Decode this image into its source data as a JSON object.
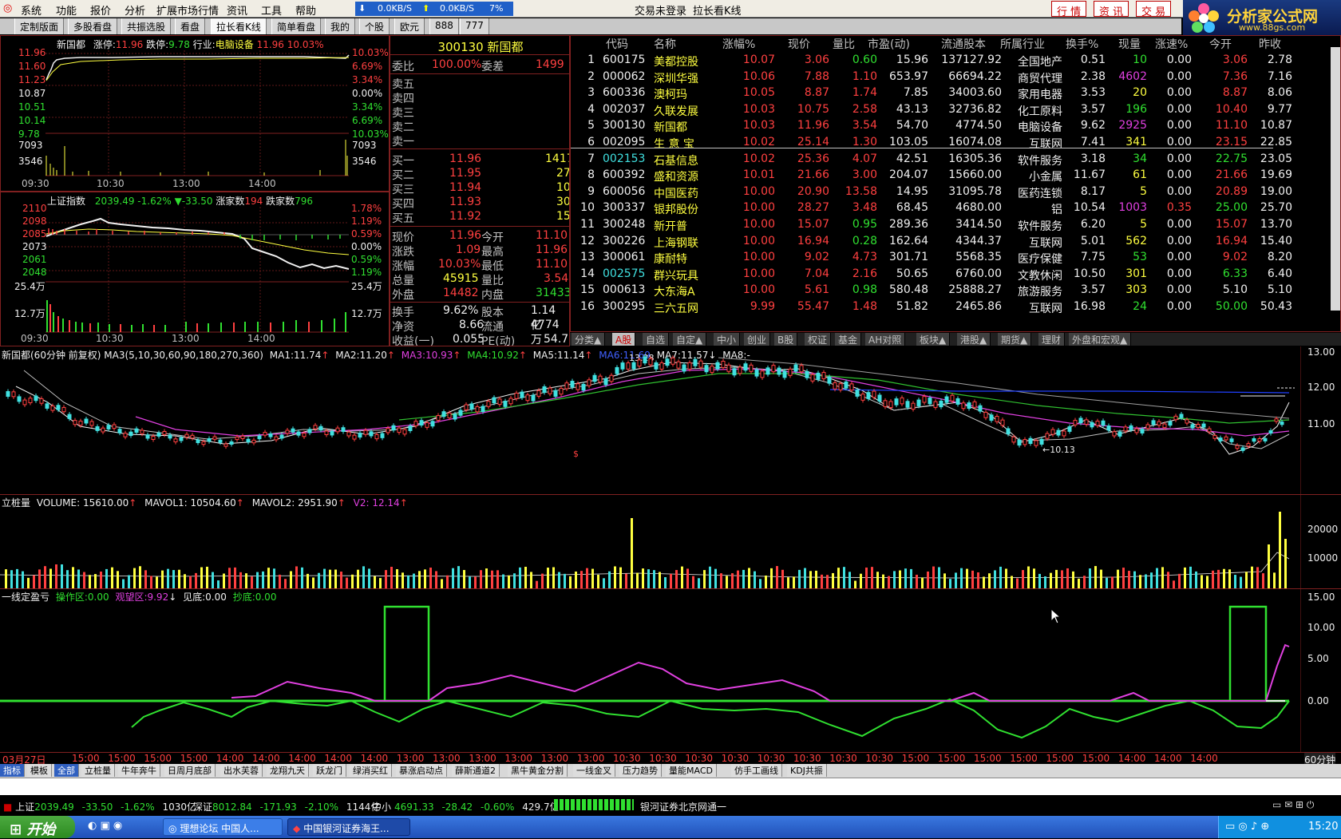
{
  "menu": {
    "items": [
      "系统",
      "功能",
      "报价",
      "分析",
      "扩展市场行情",
      "资讯",
      "工具",
      "帮助"
    ],
    "net_down": "0.0KB/S",
    "net_up": "0.0KB/S",
    "net_pct": "7%",
    "login_status": "交易未登录",
    "view_title": "拉长看K线",
    "btn_quote": "行 情",
    "btn_news": "资 讯",
    "btn_trade": "交 易"
  },
  "logo": {
    "text": "分析家公式网",
    "url": "www.88gs.com"
  },
  "tabs": [
    "定制版面",
    "多股看盘",
    "共振选股",
    "看盘",
    "拉长看K线",
    "简单看盘",
    "我的",
    "个股",
    "欧元",
    "888",
    "777"
  ],
  "stock_chart": {
    "name": "新国都",
    "limit_up_label": "涨停:",
    "limit_up": "11.96",
    "limit_down_label": "跌停:",
    "limit_down": "9.78",
    "industry_label": "行业:",
    "industry": "电脑设备",
    "price": "11.96",
    "pct": "10.03%",
    "left_ticks": [
      "11.96",
      "11.60",
      "11.23",
      "10.87",
      "10.51",
      "10.14",
      "9.78",
      "7093",
      "3546"
    ],
    "right_ticks": [
      "10.03%",
      "6.69%",
      "3.34%",
      "0.00%",
      "3.34%",
      "6.69%",
      "10.03%",
      "7093",
      "3546"
    ],
    "times": [
      "09:30",
      "10:30",
      "13:00",
      "14:00"
    ]
  },
  "index_chart": {
    "name": "上证指数",
    "value": "2039.49",
    "pct": "-1.62%",
    "chg": "▼-33.50",
    "up_label": "涨家数",
    "up": "194",
    "down_label": "跌家数",
    "down": "796",
    "left_ticks": [
      "2110",
      "2098",
      "2085",
      "2073",
      "2061",
      "2048",
      "25.4万",
      "12.7万"
    ],
    "right_ticks": [
      "1.78%",
      "1.19%",
      "0.59%",
      "0.00%",
      "0.59%",
      "1.19%",
      "25.4万",
      "12.7万"
    ],
    "times": [
      "09:30",
      "10:30",
      "13:00",
      "14:00"
    ]
  },
  "quote": {
    "code": "300130",
    "name": "新国都",
    "wb_label": "委比",
    "wb": "100.00%",
    "wc_label": "委差",
    "wc": "1499",
    "sells": [
      {
        "l": "卖五"
      },
      {
        "l": "卖四"
      },
      {
        "l": "卖三"
      },
      {
        "l": "卖二"
      },
      {
        "l": "卖一"
      }
    ],
    "buys": [
      {
        "l": "买一",
        "p": "11.96",
        "v": "1417"
      },
      {
        "l": "买二",
        "p": "11.95",
        "v": "27"
      },
      {
        "l": "买三",
        "p": "11.94",
        "v": "10"
      },
      {
        "l": "买四",
        "p": "11.93",
        "v": "30"
      },
      {
        "l": "买五",
        "p": "11.92",
        "v": "15"
      }
    ],
    "stats": [
      [
        "现价",
        "11.96",
        "今开",
        "11.10"
      ],
      [
        "涨跌",
        "1.09",
        "最高",
        "11.96"
      ],
      [
        "涨幅",
        "10.03%",
        "最低",
        "11.10"
      ],
      [
        "总量",
        "45915",
        "量比",
        "3.54"
      ],
      [
        "外盘",
        "14482",
        "内盘",
        "31433"
      ]
    ],
    "stats2": [
      [
        "换手",
        "9.62%",
        "股本",
        "1.14亿"
      ],
      [
        "净资",
        "8.66",
        "流通",
        "4774万"
      ],
      [
        "收益(一)",
        "0.055",
        "PE(动)",
        "54.7"
      ]
    ]
  },
  "table": {
    "headers": [
      "代码",
      "名称",
      "涨幅%",
      "现价",
      "量比",
      "市盈(动)",
      "流通股本",
      "所属行业",
      "换手%",
      "现量",
      "涨速%",
      "今开",
      "昨收"
    ],
    "rows": [
      [
        "1",
        "600175",
        "美都控股",
        "10.07",
        "3.06",
        "0.60",
        "15.96",
        "137127.92",
        "全国地产",
        "0.51",
        "10",
        "0.00",
        "3.06",
        "2.78"
      ],
      [
        "2",
        "000062",
        "深圳华强",
        "10.06",
        "7.88",
        "1.10",
        "653.97",
        "66694.22",
        "商贸代理",
        "2.38",
        "4602",
        "0.00",
        "7.36",
        "7.16"
      ],
      [
        "3",
        "600336",
        "澳柯玛",
        "10.05",
        "8.87",
        "1.74",
        "7.85",
        "34003.60",
        "家用电器",
        "3.53",
        "20",
        "0.00",
        "8.87",
        "8.06"
      ],
      [
        "4",
        "002037",
        "久联发展",
        "10.03",
        "10.75",
        "2.58",
        "43.13",
        "32736.82",
        "化工原料",
        "3.57",
        "196",
        "0.00",
        "10.40",
        "9.77"
      ],
      [
        "5",
        "300130",
        "新国都",
        "10.03",
        "11.96",
        "3.54",
        "54.70",
        "4774.50",
        "电脑设备",
        "9.62",
        "2925",
        "0.00",
        "11.10",
        "10.87"
      ],
      [
        "6",
        "002095",
        "生 意 宝",
        "10.02",
        "25.14",
        "1.30",
        "103.05",
        "16074.08",
        "互联网",
        "7.41",
        "341",
        "0.00",
        "23.15",
        "22.85"
      ],
      [
        "7",
        "002153",
        "石基信息",
        "10.02",
        "25.36",
        "4.07",
        "42.51",
        "16305.36",
        "软件服务",
        "3.18",
        "34",
        "0.00",
        "22.75",
        "23.05"
      ],
      [
        "8",
        "600392",
        "盛和资源",
        "10.01",
        "21.66",
        "3.00",
        "204.07",
        "15660.00",
        "小金属",
        "11.67",
        "61",
        "0.00",
        "21.66",
        "19.69"
      ],
      [
        "9",
        "600056",
        "中国医药",
        "10.00",
        "20.90",
        "13.58",
        "14.95",
        "31095.78",
        "医药连锁",
        "8.17",
        "5",
        "0.00",
        "20.89",
        "19.00"
      ],
      [
        "10",
        "300337",
        "银邦股份",
        "10.00",
        "28.27",
        "3.48",
        "68.45",
        "4680.00",
        "铝",
        "10.54",
        "1003",
        "0.35",
        "25.00",
        "25.70"
      ],
      [
        "11",
        "300248",
        "新开普",
        "10.00",
        "15.07",
        "0.95",
        "289.36",
        "3414.50",
        "软件服务",
        "6.20",
        "5",
        "0.00",
        "15.07",
        "13.70"
      ],
      [
        "12",
        "300226",
        "上海钢联",
        "10.00",
        "16.94",
        "0.28",
        "162.64",
        "4344.37",
        "互联网",
        "5.01",
        "562",
        "0.00",
        "16.94",
        "15.40"
      ],
      [
        "13",
        "300061",
        "康耐特",
        "10.00",
        "9.02",
        "4.73",
        "301.71",
        "5568.35",
        "医疗保健",
        "7.75",
        "53",
        "0.00",
        "9.02",
        "8.20"
      ],
      [
        "14",
        "002575",
        "群兴玩具",
        "10.00",
        "7.04",
        "2.16",
        "50.65",
        "6760.00",
        "文教休闲",
        "10.50",
        "301",
        "0.00",
        "6.33",
        "6.40"
      ],
      [
        "15",
        "000613",
        "大东海A",
        "10.00",
        "5.61",
        "0.98",
        "580.48",
        "25888.27",
        "旅游服务",
        "3.57",
        "303",
        "0.00",
        "5.10",
        "5.10"
      ],
      [
        "16",
        "300295",
        "三六五网",
        "9.99",
        "55.47",
        "1.48",
        "51.82",
        "2465.86",
        "互联网",
        "16.98",
        "24",
        "0.00",
        "50.00",
        "50.43"
      ]
    ],
    "bottom_tabs": [
      "分类▲",
      "A股",
      "自选",
      "自定▲",
      "中小",
      "创业",
      "B股",
      "权证",
      "基金",
      "AH对照",
      "板块▲",
      "港股▲",
      "期货▲",
      "理财",
      "外盘和宏观▲"
    ]
  },
  "kline": {
    "title": "新国都(60分钟 前复权)",
    "ma_label": "MA3(5,10,30,60,90,180,270,360)",
    "ma": [
      [
        "MA1:",
        "11.74"
      ],
      [
        "MA2:",
        "11.20"
      ],
      [
        "MA3:",
        "10.93"
      ],
      [
        "MA4:",
        "10.92"
      ],
      [
        "MA5:",
        "11.14"
      ],
      [
        "MA6:",
        "11.69"
      ],
      [
        "MA7:",
        "11.57"
      ],
      [
        "MA8:",
        "-"
      ]
    ],
    "y_ticks": [
      "13.00",
      "12.00",
      "11.00"
    ],
    "high_label": "13.28",
    "low_label": "←10.13"
  },
  "volume": {
    "title": "立桩量",
    "vol": "VOLUME: 15610.00",
    "mavol1": "MAVOL1: 10504.60",
    "mavol2": "MAVOL2: 2951.90",
    "v2": "V2: 12.14",
    "y_ticks": [
      "20000",
      "10000"
    ]
  },
  "indicator": {
    "title": "一线定盈亏",
    "op_label": "操作区:",
    "op": "0.00",
    "watch_label": "观望区:",
    "watch": "9.92",
    "bottom_label": "见底:",
    "bottom": "0.00",
    "buy_label": "抄底:",
    "buy": "0.00",
    "y_ticks": [
      "15.00",
      "10.00",
      "5.00",
      "0.00"
    ]
  },
  "time_axis": {
    "first": "03月27日",
    "labels": [
      "15:00",
      "15:00",
      "15:00",
      "15:00",
      "14:00",
      "14:00",
      "14:00",
      "14:00",
      "14:00",
      "13:00",
      "13:00",
      "13:00",
      "13:00",
      "13:00",
      "13:00",
      "10:30",
      "10:30",
      "10:30",
      "10:30",
      "10:30",
      "10:30",
      "10:30",
      "10:30",
      "15:00",
      "15:00",
      "15:00",
      "15:00",
      "15:00",
      "15:00",
      "14:00",
      "14:00",
      "14:00"
    ],
    "period": "60分钟"
  },
  "ind_tabs": [
    "指标",
    "模板",
    "全部",
    "立桩量",
    "牛年奔牛",
    "日周月底部",
    "出水芙蓉",
    "龙翔九天",
    "跃龙门",
    "绿消买红",
    "暴涨启动点",
    "薛斯通道2",
    "黑牛黄金分割",
    "一线金叉",
    "压力趋势",
    "量能MACD",
    "仿手工画线",
    "KDJ共振"
  ],
  "status": {
    "sh_label": "上证",
    "sh": "2039.49",
    "sh_chg": "-33.50",
    "sh_pct": "-1.62%",
    "sh_amt": "1030亿",
    "sz_label": "深证",
    "sz": "8012.84",
    "sz_chg": "-171.93",
    "sz_pct": "-2.10%",
    "sz_amt": "1144亿",
    "zx_label": "中小",
    "zx": "4691.33",
    "zx_chg": "-28.42",
    "zx_pct": "-0.60%",
    "zx_amt": "429.7亿",
    "broker": "银河证券北京网通一"
  },
  "taskbar": {
    "start": "开始",
    "app1": "理想论坛 中国人...",
    "app2": "中国银河证券海王...",
    "clock": "15:20"
  }
}
